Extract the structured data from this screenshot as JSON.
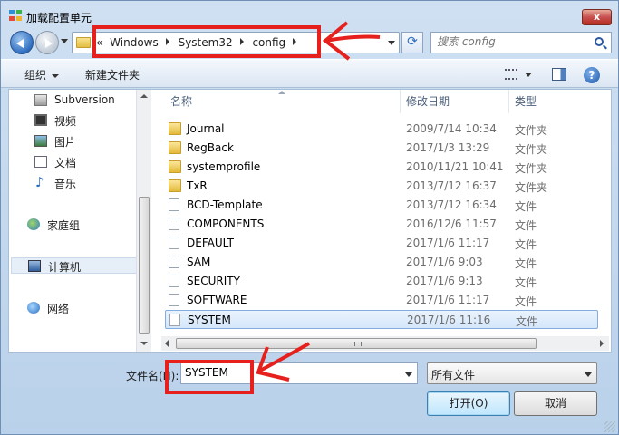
{
  "window": {
    "title": "加载配置单元",
    "close_label": "x"
  },
  "address": {
    "crumbs": [
      "Windows",
      "System32",
      "config"
    ],
    "leading": "«"
  },
  "search": {
    "placeholder": "搜索 config"
  },
  "toolbar": {
    "organize": "组织",
    "new_folder": "新建文件夹",
    "help": "?"
  },
  "nav_pane": {
    "items": [
      {
        "label": "Subversion",
        "icon": "svn-icon"
      },
      {
        "label": "视频",
        "icon": "video-icon"
      },
      {
        "label": "图片",
        "icon": "picture-icon"
      },
      {
        "label": "文档",
        "icon": "document-icon"
      },
      {
        "label": "音乐",
        "icon": "music-icon"
      },
      {
        "label": "家庭组",
        "icon": "homegroup-icon"
      },
      {
        "label": "计算机",
        "icon": "computer-icon"
      },
      {
        "label": "网络",
        "icon": "network-icon"
      }
    ]
  },
  "file_list": {
    "headers": {
      "name": "名称",
      "date": "修改日期",
      "type": "类型"
    },
    "rows": [
      {
        "name": "Journal",
        "date": "2009/7/14 10:34",
        "type": "文件夹",
        "kind": "folder"
      },
      {
        "name": "RegBack",
        "date": "2017/1/3 13:29",
        "type": "文件夹",
        "kind": "folder"
      },
      {
        "name": "systemprofile",
        "date": "2010/11/21 10:41",
        "type": "文件夹",
        "kind": "folder"
      },
      {
        "name": "TxR",
        "date": "2013/7/12 16:37",
        "type": "文件夹",
        "kind": "folder"
      },
      {
        "name": "BCD-Template",
        "date": "2013/7/12 16:34",
        "type": "文件",
        "kind": "file"
      },
      {
        "name": "COMPONENTS",
        "date": "2016/12/6 11:57",
        "type": "文件",
        "kind": "file"
      },
      {
        "name": "DEFAULT",
        "date": "2017/1/6 11:17",
        "type": "文件",
        "kind": "file"
      },
      {
        "name": "SAM",
        "date": "2017/1/6 9:03",
        "type": "文件",
        "kind": "file"
      },
      {
        "name": "SECURITY",
        "date": "2017/1/6 9:13",
        "type": "文件",
        "kind": "file"
      },
      {
        "name": "SOFTWARE",
        "date": "2017/1/6 11:17",
        "type": "文件",
        "kind": "file"
      },
      {
        "name": "SYSTEM",
        "date": "2017/1/6 11:16",
        "type": "文件",
        "kind": "file"
      }
    ]
  },
  "bottom": {
    "filename_label": "文件名(N):",
    "filename_value": "SYSTEM",
    "filetype_value": "所有文件",
    "open_label": "打开(O)",
    "cancel_label": "取消"
  },
  "colors": {
    "annotation": "#e6201d",
    "selection": "#d5e7fb",
    "accent": "#2f6fc0"
  }
}
